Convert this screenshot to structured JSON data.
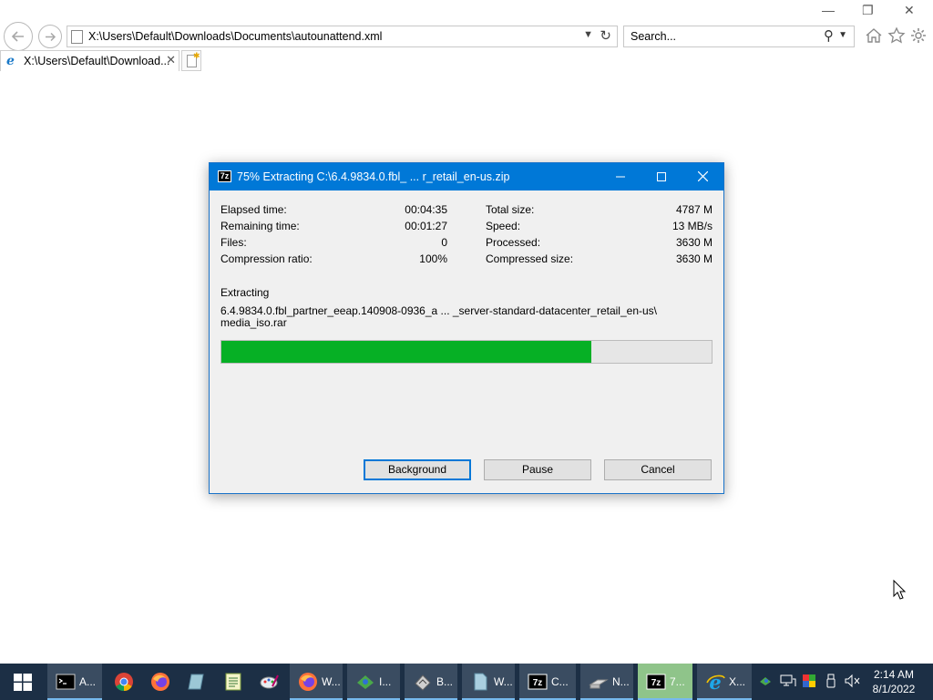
{
  "browser": {
    "address": "X:\\Users\\Default\\Downloads\\Documents\\autounattend.xml",
    "search_placeholder": "Search...",
    "tab_title": "X:\\Users\\Default\\Download...",
    "tab_close": "✕",
    "icons": {
      "back": "back-arrow-icon",
      "forward": "forward-arrow-icon",
      "home": "home-icon",
      "favorites": "star-icon",
      "tools": "gear-icon"
    }
  },
  "window_controls": {
    "minimize": "—",
    "restore": "❐",
    "close": "✕"
  },
  "dialog": {
    "app_icon_text": "7z",
    "title": "75% Extracting C:\\6.4.9834.0.fbl_ ... r_retail_en-us.zip",
    "stats_left": [
      {
        "label": "Elapsed time:",
        "value": "00:04:35"
      },
      {
        "label": "Remaining time:",
        "value": "00:01:27"
      },
      {
        "label": "Files:",
        "value": "0"
      },
      {
        "label": "Compression ratio:",
        "value": "100%"
      }
    ],
    "stats_right": [
      {
        "label": "Total size:",
        "value": "4787 M"
      },
      {
        "label": "Speed:",
        "value": "13 MB/s"
      },
      {
        "label": "Processed:",
        "value": "3630 M"
      },
      {
        "label": "Compressed size:",
        "value": "3630 M"
      }
    ],
    "operation_label": "Extracting",
    "current_file_line1": "6.4.9834.0.fbl_partner_eeap.140908-0936_a ... _server-standard-datacenter_retail_en-us\\",
    "current_file_line2": "media_iso.rar",
    "progress_fraction": 0.755,
    "progress_color": "#06b025",
    "buttons": {
      "background": "Background",
      "pause": "Pause",
      "cancel": "Cancel"
    }
  },
  "taskbar": {
    "apps": [
      {
        "name": "taskbar-cmd",
        "label": "A...",
        "icon": "cmd-icon"
      },
      {
        "name": "taskbar-chrome",
        "label": "",
        "icon": "chrome-icon"
      },
      {
        "name": "taskbar-firefox",
        "label": "",
        "icon": "firefox-icon"
      },
      {
        "name": "taskbar-notes",
        "label": "",
        "icon": "notes-icon"
      },
      {
        "name": "taskbar-notepad",
        "label": "",
        "icon": "notepad-icon"
      },
      {
        "name": "taskbar-paint",
        "label": "",
        "icon": "paint-icon"
      },
      {
        "name": "taskbar-firefox-window",
        "label": "W...",
        "icon": "firefox-icon"
      },
      {
        "name": "taskbar-install",
        "label": "I...",
        "icon": "install-icon"
      },
      {
        "name": "taskbar-b",
        "label": "B...",
        "icon": "tool-icon"
      },
      {
        "name": "taskbar-w",
        "label": "W...",
        "icon": "file-icon"
      },
      {
        "name": "taskbar-7zip-c",
        "label": "C...",
        "icon": "7zip-icon"
      },
      {
        "name": "taskbar-n",
        "label": "N...",
        "icon": "drive-icon"
      },
      {
        "name": "taskbar-7zip-active",
        "label": "7...",
        "icon": "7zip-icon"
      },
      {
        "name": "taskbar-ie",
        "label": "X...",
        "icon": "ie-icon"
      }
    ],
    "time": "2:14 AM",
    "date": "8/1/2022"
  }
}
